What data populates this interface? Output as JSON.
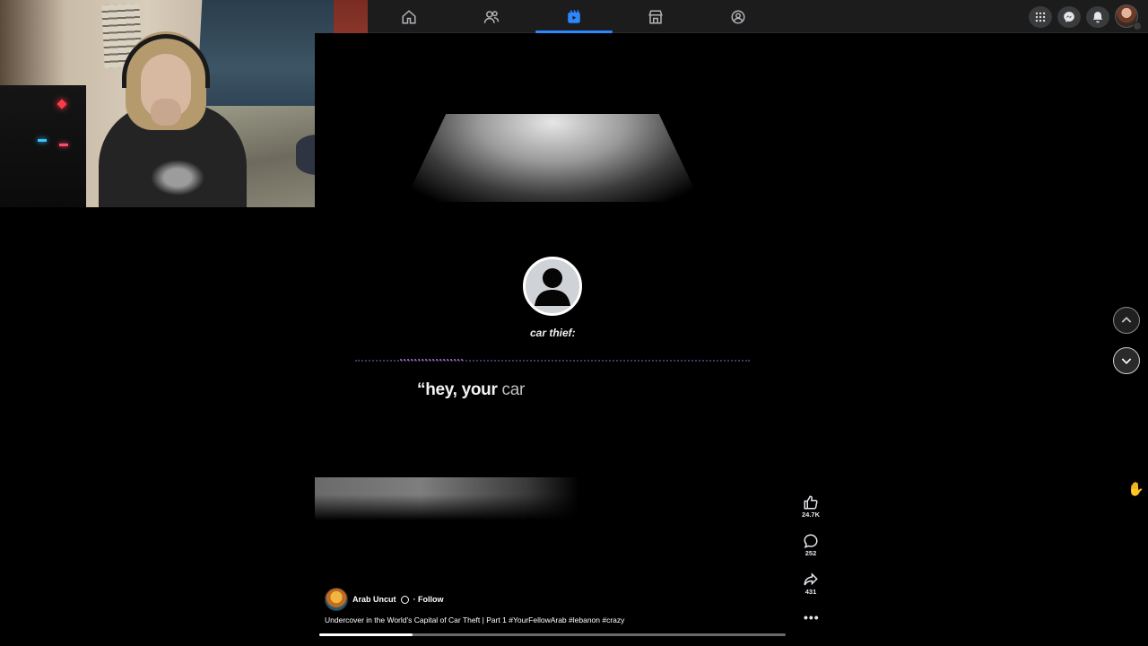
{
  "webcam": {
    "label": "webcam-overlay"
  },
  "topnav": {
    "tabs": [
      {
        "name": "home",
        "icon": "home-icon"
      },
      {
        "name": "friends",
        "icon": "friends-icon"
      },
      {
        "name": "video",
        "icon": "video-icon",
        "active": true
      },
      {
        "name": "marketplace",
        "icon": "marketplace-icon"
      },
      {
        "name": "groups",
        "icon": "groups-icon"
      }
    ],
    "accent": "#2d88ff",
    "right": [
      "menu-grid-icon",
      "messenger-icon",
      "bell-icon",
      "profile-avatar"
    ]
  },
  "reel": {
    "speaker": "car thief:",
    "caption_main": "“hey, your",
    "caption_dim": " car",
    "owner": "Arab Uncut",
    "follow": "· Follow",
    "description": "Undercover in the World's Capital of Car Theft | Part 1 #YourFellowArab #lebanon #crazy",
    "progress": 0.2
  },
  "actions": {
    "likes": "24.7K",
    "comments": "252",
    "shares": "431",
    "more": "•••"
  },
  "nav": {
    "prev": "chevron-up-icon",
    "next": "chevron-down-icon"
  }
}
